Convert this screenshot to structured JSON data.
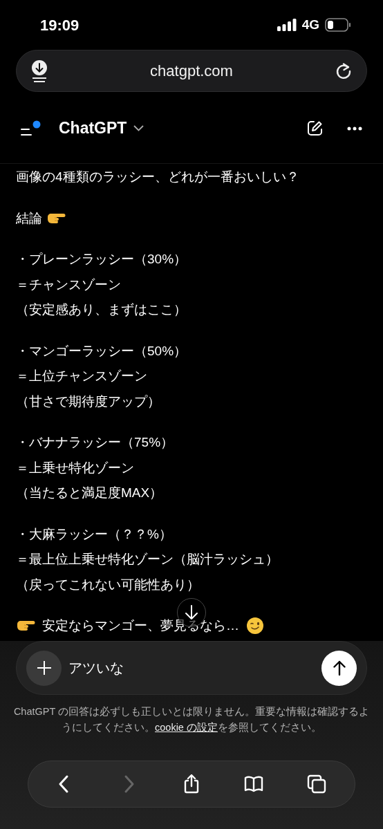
{
  "status_bar": {
    "time": "19:09",
    "network": "4G"
  },
  "browser": {
    "url": "chatgpt.com"
  },
  "header": {
    "title": "ChatGPT",
    "unread": true
  },
  "message": {
    "blocks": [
      {
        "kind": "plain",
        "lines": [
          "画像の4種類のラッシー、どれが一番おいしい？"
        ]
      },
      {
        "kind": "heading",
        "lines": [
          "結論"
        ]
      },
      {
        "kind": "plain",
        "lines": [
          "・プレーンラッシー（30%）",
          "＝チャンスゾーン",
          "（安定感あり、まずはここ）"
        ]
      },
      {
        "kind": "plain",
        "lines": [
          "・マンゴーラッシー（50%）",
          "＝上位チャンスゾーン",
          "（甘さで期待度アップ）"
        ]
      },
      {
        "kind": "plain",
        "lines": [
          "・バナナラッシー（75%）",
          "＝上乗せ特化ゾーン",
          "（当たると満足度MAX）"
        ]
      },
      {
        "kind": "plain",
        "lines": [
          "・大麻ラッシー（？？%）",
          "＝最上位上乗せ特化ゾーン（脳汁ラッシュ）",
          "（戻ってこれない可能性あり）"
        ]
      },
      {
        "kind": "closing",
        "lines": [
          "安定ならマンゴー、夢見るなら…"
        ]
      }
    ]
  },
  "composer": {
    "value": "アツいな"
  },
  "disclaimer": {
    "before": "ChatGPT の回答は必ずしも正しいとは限りません。重要な情報は確認するようにしてください。",
    "link": "cookie の設定",
    "after": "を参照してください。"
  },
  "toolbar": [
    {
      "kind": "back",
      "disabled": false
    },
    {
      "kind": "forward",
      "disabled": true
    },
    {
      "kind": "share",
      "disabled": false
    },
    {
      "kind": "bookmarks",
      "disabled": false
    },
    {
      "kind": "tabs",
      "disabled": false
    }
  ]
}
